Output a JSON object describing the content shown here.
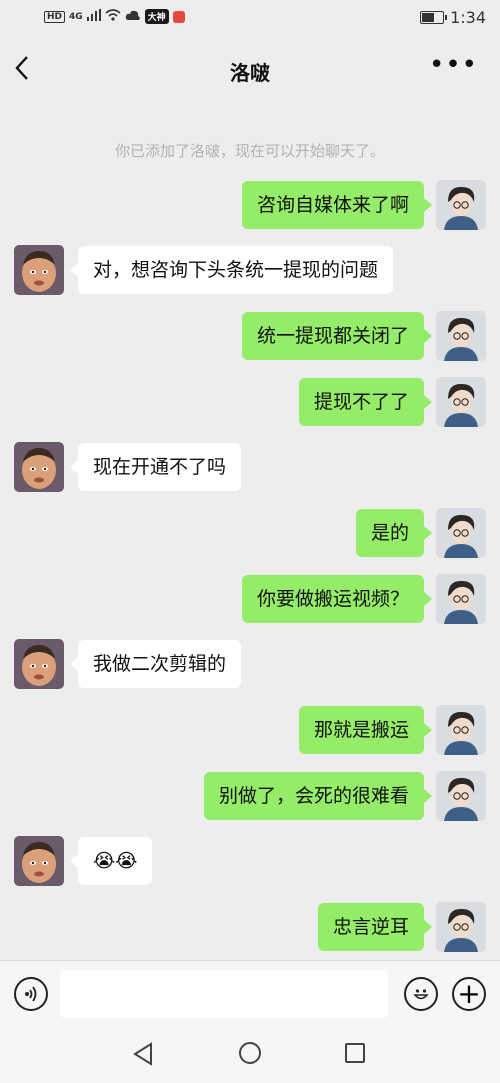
{
  "status_bar": {
    "left_text": "HD",
    "network": "4G",
    "app_badge_1": "大神",
    "time": "1:34",
    "colors": {
      "badge_1": "#1a1a1a",
      "badge_2": "#e5483d"
    }
  },
  "header": {
    "title": "洛啵",
    "back_icon": "chevron-left-icon",
    "more_icon": "more-dots-icon",
    "more_glyph": "•••"
  },
  "system_message": "你已添加了洛啵，现在可以开始聊天了。",
  "messages": [
    {
      "side": "me",
      "text": "咨询自媒体来了啊"
    },
    {
      "side": "them",
      "text": "对，想咨询下头条统一提现的问题"
    },
    {
      "side": "me",
      "text": "统一提现都关闭了"
    },
    {
      "side": "me",
      "text": "提现不了了"
    },
    {
      "side": "them",
      "text": "现在开通不了吗"
    },
    {
      "side": "me",
      "text": "是的"
    },
    {
      "side": "me",
      "text": "你要做搬运视频？"
    },
    {
      "side": "them",
      "text": "我做二次剪辑的"
    },
    {
      "side": "me",
      "text": "那就是搬运"
    },
    {
      "side": "me",
      "text": "别做了，会死的很难看"
    },
    {
      "side": "them",
      "text": "😭😭"
    },
    {
      "side": "me",
      "text": "忠言逆耳"
    }
  ],
  "input_bar": {
    "voice_icon": "voice-icon",
    "emoji_icon": "emoji-icon",
    "plus_icon": "plus-icon",
    "plus_glyph": "+"
  },
  "nav_bar": {
    "back_icon": "triangle-back-icon",
    "home_icon": "circle-home-icon",
    "recent_icon": "square-recent-icon"
  },
  "colors": {
    "background": "#ededed",
    "my_bubble": "#95ec69",
    "their_bubble": "#ffffff",
    "system_text": "#b2b2b2"
  }
}
